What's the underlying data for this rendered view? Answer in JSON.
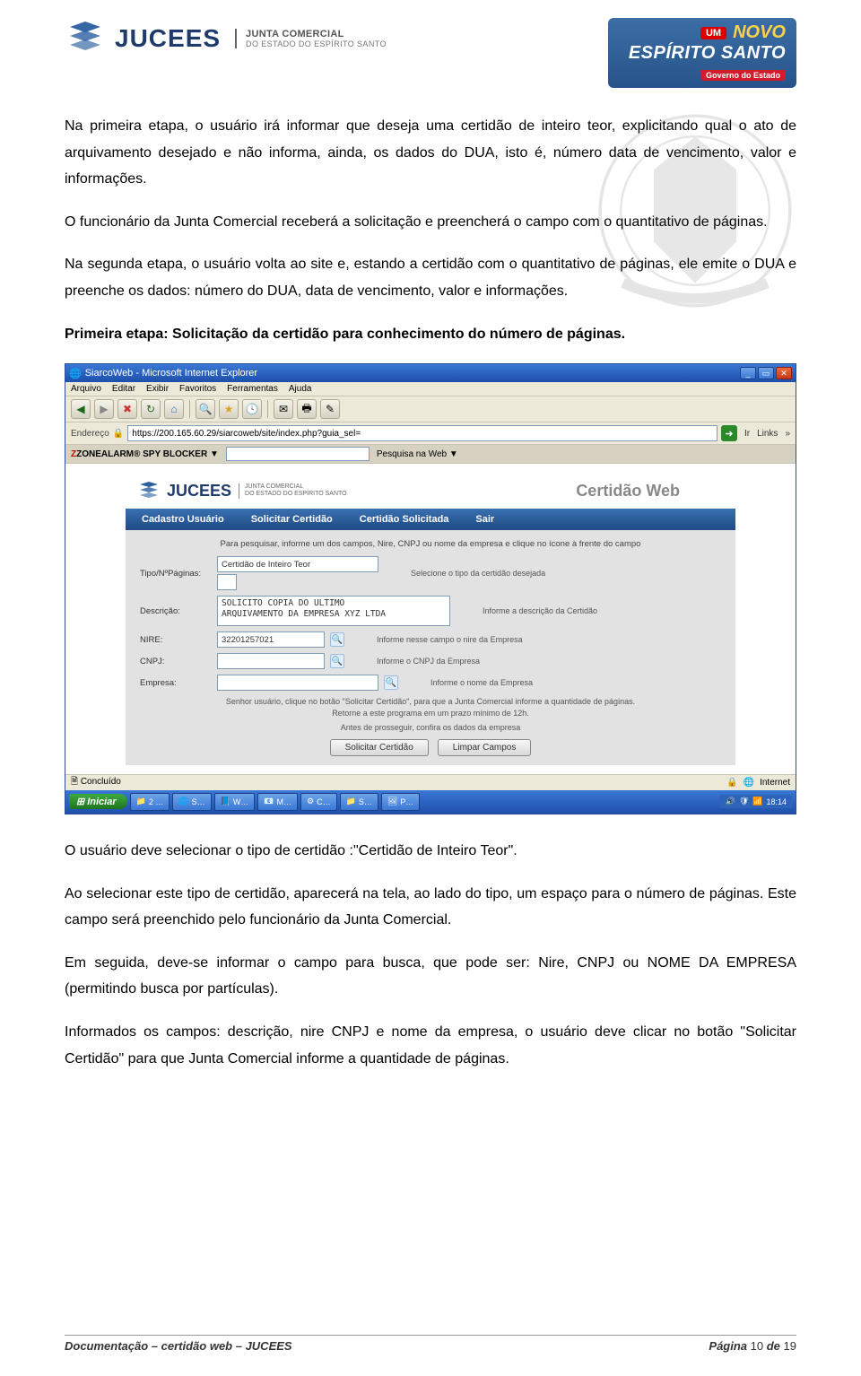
{
  "header": {
    "logo_name": "JUCEES",
    "logo_sub1": "JUNTA COMERCIAL",
    "logo_sub2": "DO ESTADO DO ESPÍRITO SANTO",
    "right_um": "UM",
    "right_novo": "NOVO",
    "right_line2": "ESPÍRITO SANTO",
    "right_sub": "Governo do Estado"
  },
  "paragraphs": {
    "p1": "Na primeira etapa, o usuário irá informar que deseja uma certidão de inteiro teor, explicitando qual o ato de arquivamento desejado e não informa, ainda, os dados do DUA, isto é, número data de vencimento, valor e informações.",
    "p2": "O funcionário da Junta Comercial receberá a solicitação e preencherá o campo com o quantitativo de páginas.",
    "p3": "Na segunda etapa, o usuário volta ao site e, estando a certidão com o quantitativo de páginas, ele emite o DUA e preenche os dados: número do DUA, data de vencimento, valor e informações.",
    "p4": "Primeira etapa: Solicitação da certidão para conhecimento do número de páginas.",
    "p5": "O usuário deve selecionar o tipo de certidão :\"Certidão de Inteiro Teor\".",
    "p6": "Ao selecionar este tipo de certidão, aparecerá na tela, ao lado do tipo, um espaço para o número de páginas. Este campo será preenchido pelo funcionário da Junta Comercial.",
    "p7": "Em seguida, deve-se informar o campo para busca, que pode ser: Nire, CNPJ ou NOME DA EMPRESA (permitindo busca por partículas).",
    "p8": "Informados os campos: descrição, nire CNPJ e nome da empresa, o usuário deve clicar no botão \"Solicitar Certidão\" para que Junta Comercial informe a quantidade de páginas."
  },
  "ie": {
    "title": "SiarcoWeb - Microsoft Internet Explorer",
    "menubar": [
      "Arquivo",
      "Editar",
      "Exibir",
      "Favoritos",
      "Ferramentas",
      "Ajuda"
    ],
    "addr_label": "Endereço",
    "addr_value": "https://200.165.60.29/siarcoweb/site/index.php?guia_sel=",
    "go": "Ir",
    "links": "Links",
    "za_brand": "ZONEALARM® SPY BLOCKER ▼",
    "za_search": "Pesquisa na Web ▼",
    "banner_title": "Certidão Web",
    "banner_sub1": "JUNTA COMERCIAL",
    "banner_sub2": "DO ESTADO DO ESPÍRITO SANTO",
    "tabs": [
      "Cadastro Usuário",
      "Solicitar Certidão",
      "Certidão Solicitada",
      "Sair"
    ],
    "hint": "Para pesquisar, informe um dos campos, Nire, CNPJ ou nome da empresa e clique no ícone à frente do campo",
    "row_tipo_label": "Tipo/NºPáginas:",
    "row_tipo_value": "Certidão de Inteiro Teor",
    "row_tipo_help": "Selecione o tipo da certidão desejada",
    "row_desc_label": "Descrição:",
    "row_desc_value": "SOLICITO COPIA DO ULTIMO\nARQUIVAMENTO DA EMPRESA XYZ LTDA",
    "row_desc_help": "Informe a descrição da Certidão",
    "row_nire_label": "NIRE:",
    "row_nire_value": "32201257021",
    "row_nire_help": "Informe nesse campo o nire da Empresa",
    "row_cnpj_label": "CNPJ:",
    "row_cnpj_help": "Informe o CNPJ da Empresa",
    "row_emp_label": "Empresa:",
    "row_emp_help": "Informe o nome da Empresa",
    "footer_text1": "Senhor usuário, clique no botão \"Solicitar Certidão\", para que a Junta Comercial informe a quantidade de páginas.\nRetorne a este programa em um prazo mínimo de 12h.",
    "footer_text2": "Antes de prosseguir, confira os dados da empresa",
    "btn_solicitar": "Solicitar Certidão",
    "btn_limpar": "Limpar Campos",
    "status_left": "Concluído",
    "status_right": "Internet",
    "start": "Iniciar",
    "tasks": [
      "2 …",
      "S…",
      "W…",
      "M…",
      "C…",
      "S…",
      "P…"
    ],
    "clock": "18:14"
  },
  "footer": {
    "left": "Documentação – certidão web – JUCEES",
    "right_prefix": "Página ",
    "right_page": "10",
    "right_mid": " de ",
    "right_total": "19"
  }
}
